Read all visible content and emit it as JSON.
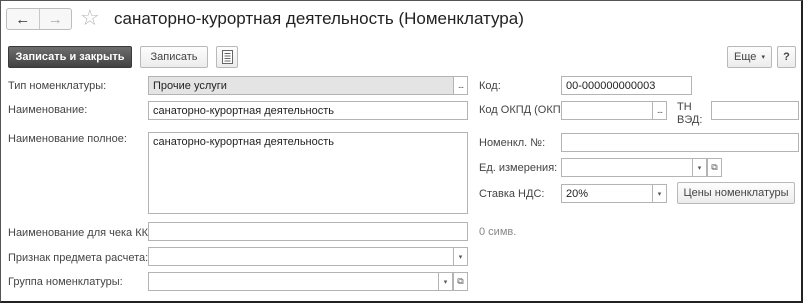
{
  "window": {
    "title": "санаторно-курортная деятельность (Номенклатура)"
  },
  "nav": {
    "back_glyph": "←",
    "forward_glyph": "→",
    "star_glyph": "☆"
  },
  "toolbar": {
    "save_close_label": "Записать и закрыть",
    "save_label": "Записать",
    "more_label": "Еще",
    "help_label": "?"
  },
  "form": {
    "type": {
      "label": "Тип номенклатуры:",
      "value": "Прочие услуги"
    },
    "name": {
      "label": "Наименование:",
      "value": "санаторно-курортная деятельность"
    },
    "full_name": {
      "label": "Наименование полное:",
      "value": "санаторно-курортная деятельность"
    },
    "receipt_name": {
      "label": "Наименование для чека ККМ:",
      "value": "",
      "counter": "0 симв."
    },
    "payment_subject": {
      "label": "Признак предмета расчета:",
      "value": ""
    },
    "group": {
      "label": "Группа номенклатуры:",
      "value": ""
    },
    "code": {
      "label": "Код:",
      "value": "00-000000000003"
    },
    "okpd": {
      "label": "Код ОКПД (ОКП):",
      "value": ""
    },
    "tnved": {
      "label": "ТН ВЭД:",
      "value": ""
    },
    "item_no": {
      "label": "Номенкл. №:",
      "value": ""
    },
    "unit": {
      "label": "Ед. измерения:",
      "value": ""
    },
    "vat": {
      "label": "Ставка НДС:",
      "value": "20%"
    },
    "prices_button": "Цены номенклатуры"
  },
  "icons": {
    "dropdown": "▾",
    "ellipsis": "...",
    "open": "⧉"
  }
}
